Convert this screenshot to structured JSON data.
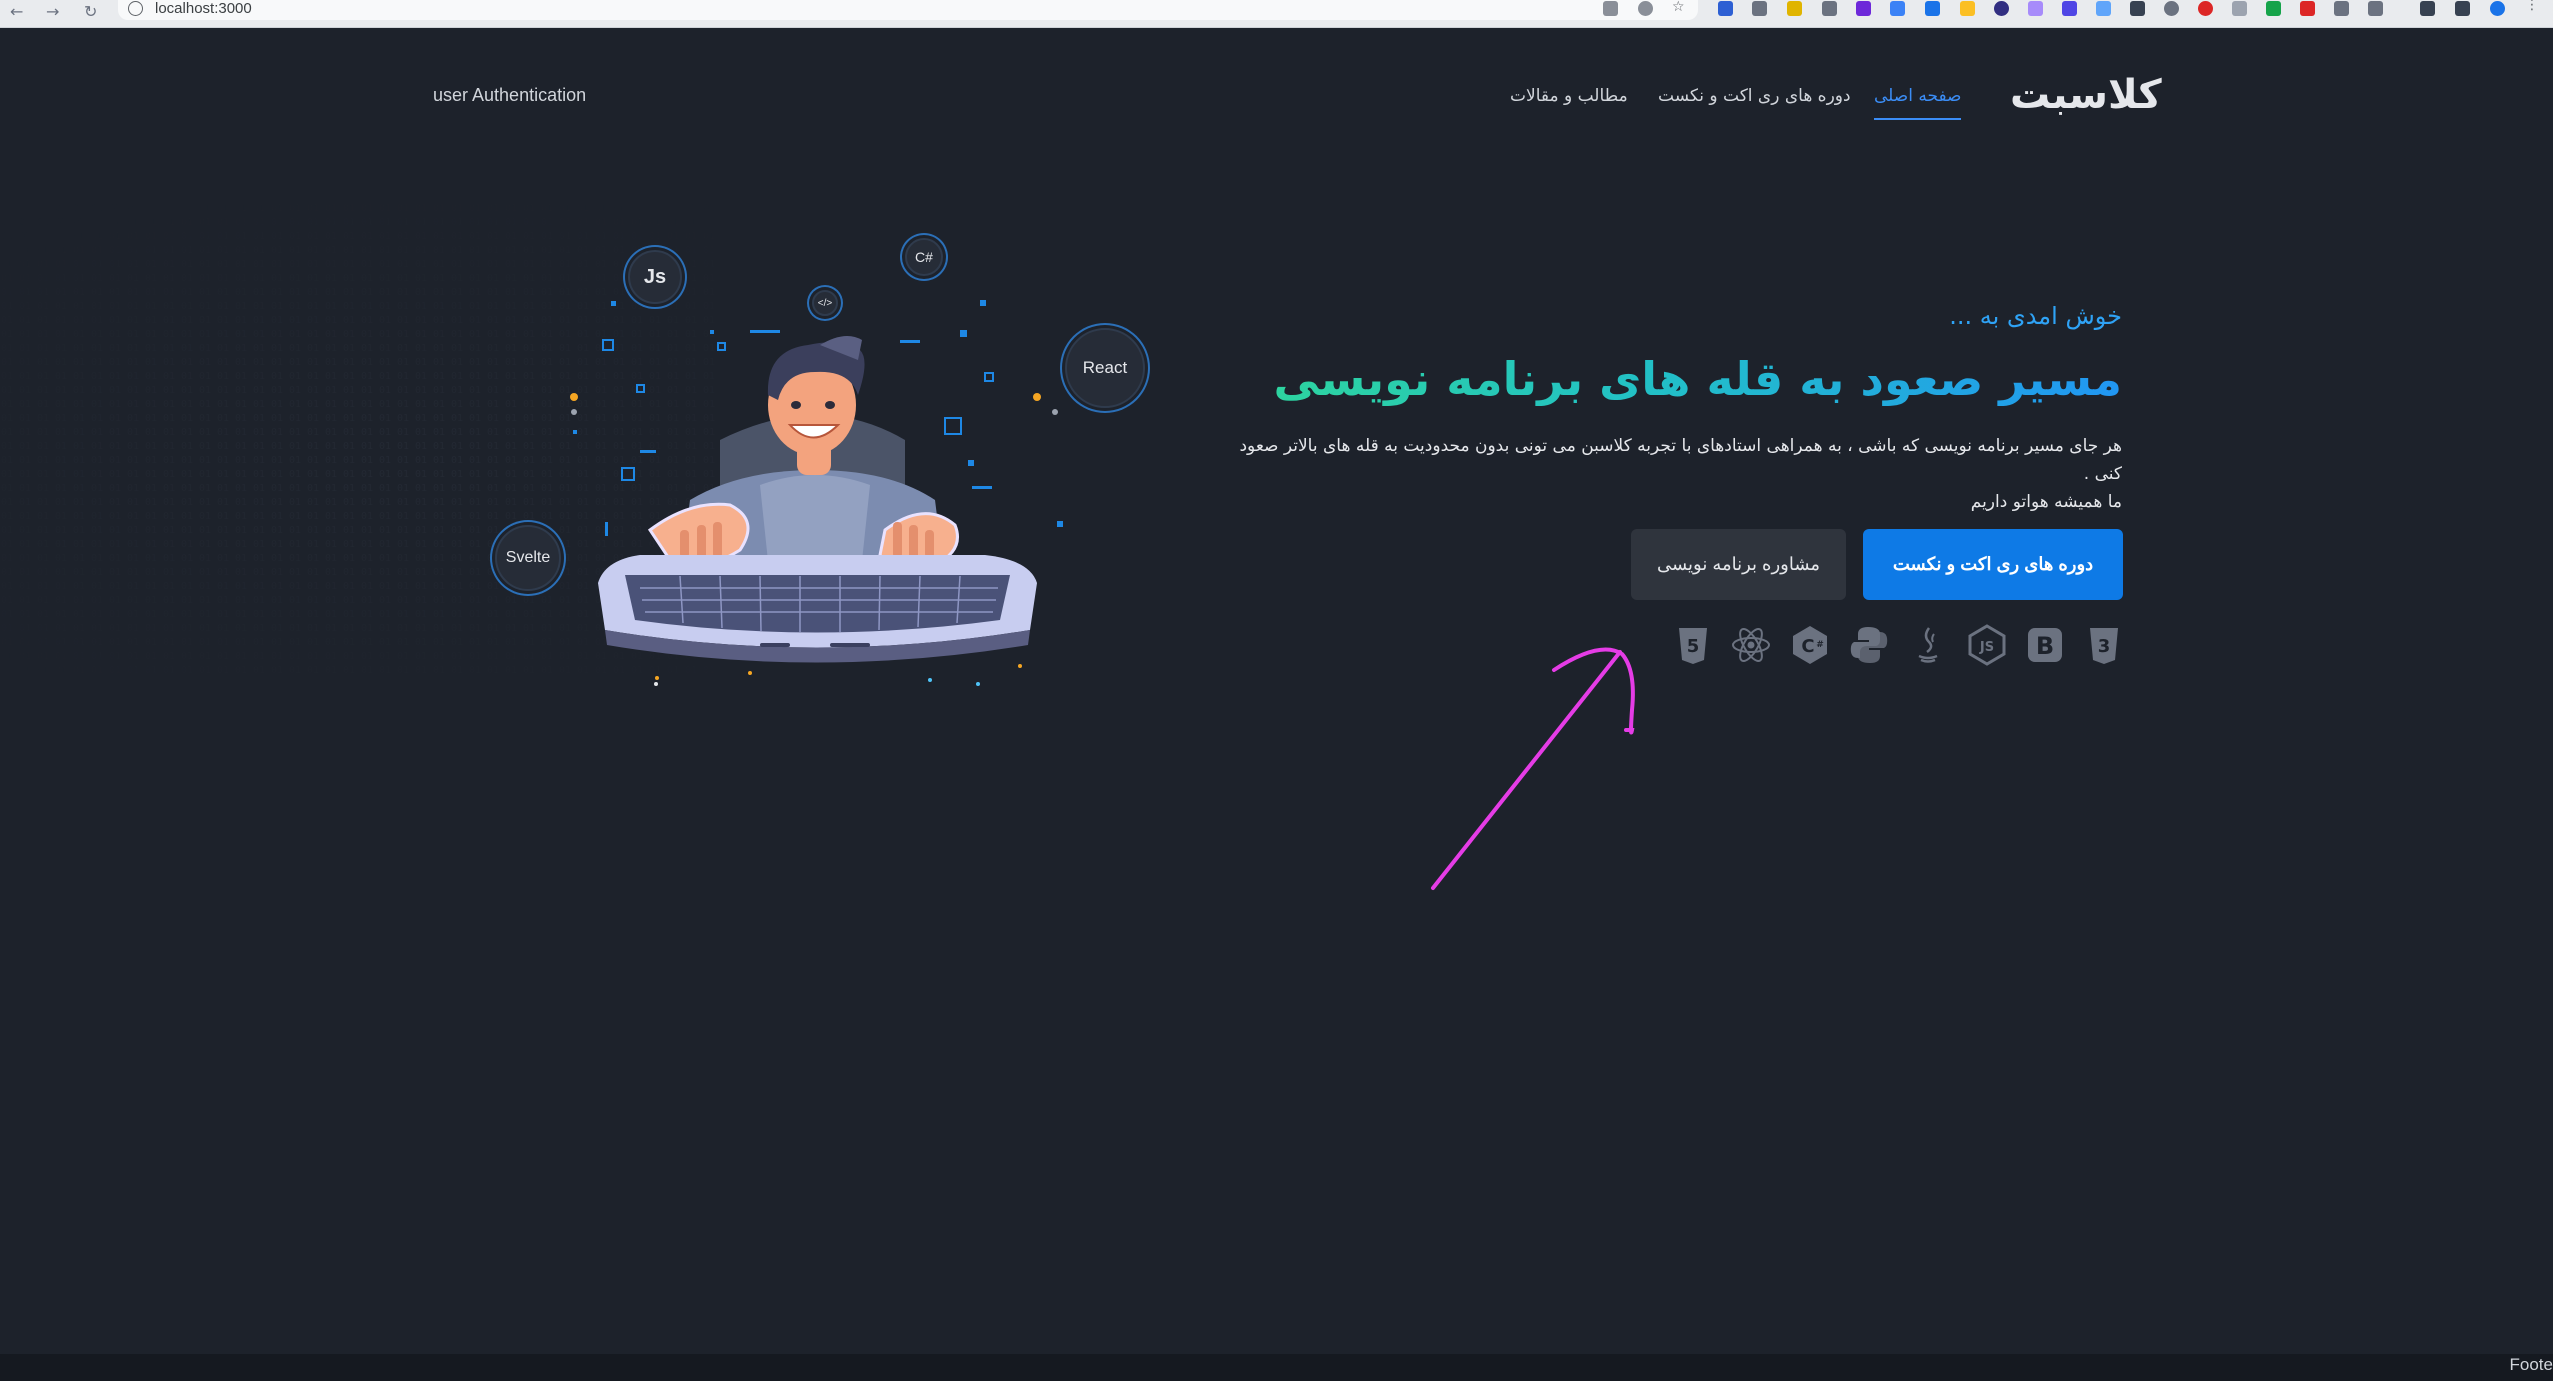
{
  "browser": {
    "url": "localhost:3000"
  },
  "header": {
    "brand": "کلاسبت",
    "nav": [
      {
        "label": "صفحه اصلی",
        "active": true
      },
      {
        "label": "دوره های ری اکت و نکست",
        "active": false
      },
      {
        "label": "مطالب و مقالات",
        "active": false
      }
    ],
    "auth_link": "user Authentication"
  },
  "hero": {
    "welcome": "خوش امدی به ...",
    "headline": "مسیر صعود به قله های برنامه نویسی",
    "description_line1": "هر جای مسیر برنامه نویسی که باشی ، به همراهی استادهای با تجربه کلاسبن می تونی بدون محدودیت به قله های بالاتر صعود کنی .",
    "description_line2": "ما همیشه هواتو داریم",
    "primary_button": "دوره های ری اکت و نکست",
    "secondary_button": "مشاوره برنامه نویسی",
    "tech_icons": [
      "css3-icon",
      "bootstrap-icon",
      "nodejs-icon",
      "java-icon",
      "python-icon",
      "csharp-icon",
      "react-icon",
      "html5-icon"
    ]
  },
  "illustration": {
    "badges": [
      "Js",
      "C#",
      "React",
      "Svelte",
      "</>"
    ]
  },
  "footer": {
    "text": "Foote"
  },
  "colors": {
    "background": "#1d222b",
    "accent": "#0e7ae6",
    "annotation_arrow": "#e53ce6"
  }
}
